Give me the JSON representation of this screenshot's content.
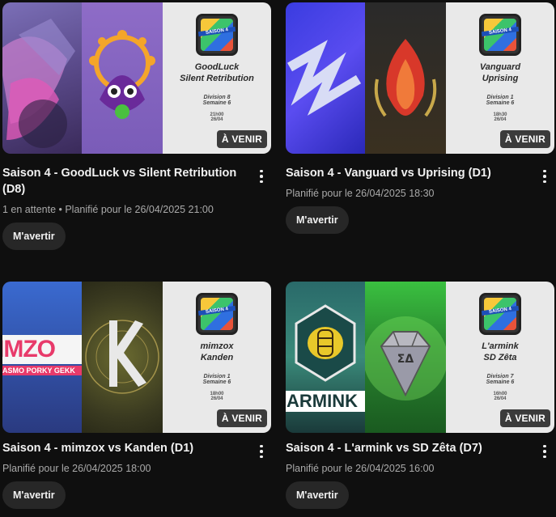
{
  "cards": [
    {
      "title": "Saison 4 - GoodLuck vs Silent Retribution (D8)",
      "meta": "1 en attente • Planifié pour le 26/04/2025 21:00",
      "remind": "M'avertir",
      "badge": "À VENIR",
      "thumb": {
        "logo_text": "SAISON 4",
        "team1": "GoodLuck",
        "team2": "Silent Retribution",
        "division": "Division 8",
        "week": "Semaine 6",
        "time": "21h00",
        "date": "26/04"
      }
    },
    {
      "title": "Saison 4 - Vanguard vs Uprising (D1)",
      "meta": "Planifié pour le 26/04/2025 18:30",
      "remind": "M'avertir",
      "badge": "À VENIR",
      "thumb": {
        "logo_text": "SAISON 4",
        "team1": "Vanguard",
        "team2": "Uprising",
        "division": "Division 1",
        "week": "Semaine 6",
        "time": "18h30",
        "date": "26/04"
      }
    },
    {
      "title": "Saison 4 - mimzox vs Kanden (D1)",
      "meta": "Planifié pour le 26/04/2025 18:00",
      "remind": "M'avertir",
      "badge": "À VENIR",
      "thumb": {
        "logo_text": "SAISON 4",
        "team1": "mimzox",
        "team2": "Kanden",
        "division": "Division 1",
        "week": "Semaine 6",
        "time": "18h00",
        "date": "26/04",
        "left_logo_text": "IMZO",
        "left_logo_sub": "ASMO PORKY GEKK"
      }
    },
    {
      "title": "Saison 4 - L'armink vs SD Zêta (D7)",
      "meta": "Planifié pour le 26/04/2025 16:00",
      "remind": "M'avertir",
      "badge": "À VENIR",
      "thumb": {
        "logo_text": "SAISON 4",
        "team1": "L'armink",
        "team2": "SD Zêta",
        "division": "Division 7",
        "week": "Semaine 6",
        "time": "16h00",
        "date": "26/04",
        "left_logo_text": "ARMINK",
        "right_logo_text": "ΣΔ"
      }
    }
  ],
  "colors": {
    "background": "#0f0f0f",
    "button": "#272727",
    "meta": "#aaaaaa"
  }
}
